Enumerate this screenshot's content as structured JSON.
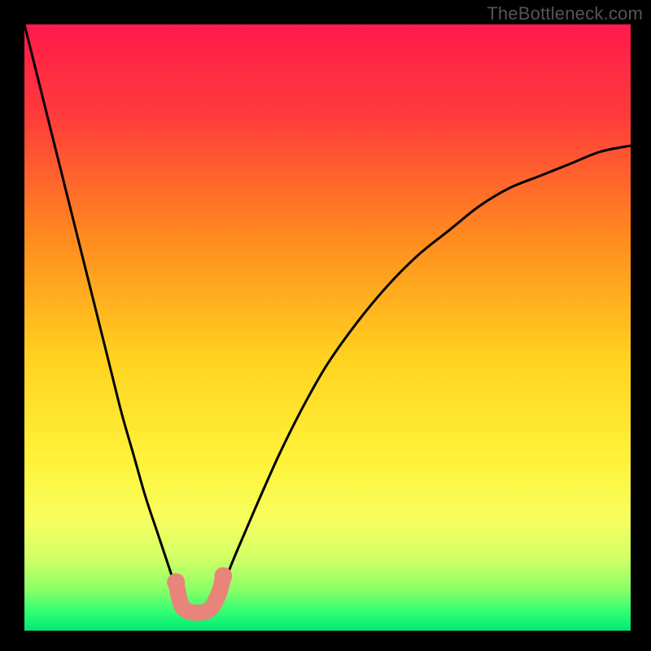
{
  "watermark": "TheBottleneck.com",
  "chart_data": {
    "type": "line",
    "title": "",
    "xlabel": "",
    "ylabel": "",
    "xlim": [
      0,
      100
    ],
    "ylim": [
      0,
      100
    ],
    "grid": false,
    "legend": false,
    "curve": {
      "name": "bottleneck-curve",
      "x": [
        0,
        2,
        4,
        6,
        8,
        10,
        12,
        14,
        16,
        18,
        20,
        22,
        24,
        25,
        26,
        27,
        28,
        29,
        30,
        31,
        32,
        33,
        35,
        38,
        42,
        46,
        50,
        55,
        60,
        65,
        70,
        75,
        80,
        85,
        90,
        95,
        100
      ],
      "y": [
        100,
        92,
        84,
        76,
        68,
        60,
        52,
        44,
        36,
        29,
        22,
        16,
        10,
        7,
        5,
        4,
        3,
        3,
        3,
        4,
        5,
        8,
        13,
        20,
        29,
        37,
        44,
        51,
        57,
        62,
        66,
        70,
        73,
        75,
        77,
        79,
        80
      ]
    },
    "highlight": {
      "name": "sweet-spot",
      "color": "#e8847a",
      "points": [
        {
          "x": 25.0,
          "y": 8.0
        },
        {
          "x": 25.5,
          "y": 5.5
        },
        {
          "x": 26.0,
          "y": 4.0
        },
        {
          "x": 27.0,
          "y": 3.2
        },
        {
          "x": 28.0,
          "y": 3.0
        },
        {
          "x": 29.0,
          "y": 3.0
        },
        {
          "x": 30.0,
          "y": 3.2
        },
        {
          "x": 31.0,
          "y": 4.0
        },
        {
          "x": 32.2,
          "y": 6.5
        },
        {
          "x": 32.8,
          "y": 9.0
        }
      ]
    },
    "background_gradient": {
      "stops": [
        {
          "pct": 0,
          "color": "#ff1a4d"
        },
        {
          "pct": 15,
          "color": "#ff3b3b"
        },
        {
          "pct": 35,
          "color": "#ff8a1f"
        },
        {
          "pct": 55,
          "color": "#ffd21f"
        },
        {
          "pct": 72,
          "color": "#fff23a"
        },
        {
          "pct": 82,
          "color": "#f6ff60"
        },
        {
          "pct": 88,
          "color": "#d2ff66"
        },
        {
          "pct": 93,
          "color": "#8fff66"
        },
        {
          "pct": 97,
          "color": "#2fff73"
        },
        {
          "pct": 100,
          "color": "#00e873"
        }
      ]
    }
  }
}
